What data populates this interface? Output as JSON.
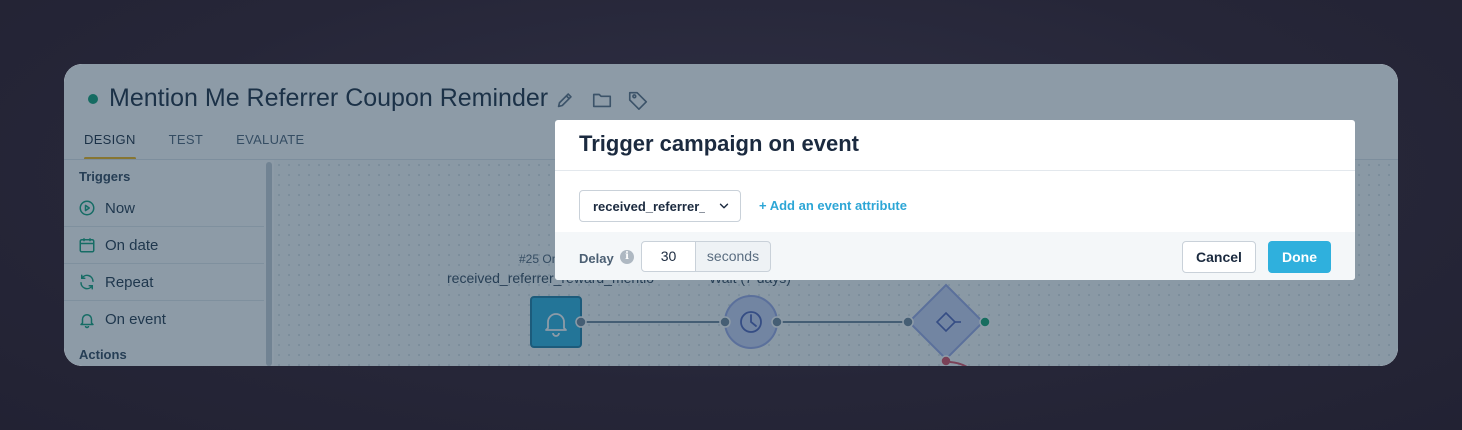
{
  "campaign": {
    "title": "Mention Me Referrer Coupon Reminder",
    "status_color": "#0f9f74",
    "header_icons": [
      "edit-icon",
      "folder-icon",
      "tag-icon"
    ]
  },
  "tabs": [
    {
      "label": "DESIGN",
      "active": true
    },
    {
      "label": "TEST",
      "active": false
    },
    {
      "label": "EVALUATE",
      "active": false
    }
  ],
  "sidebar": {
    "triggers_heading": "Triggers",
    "items": [
      {
        "label": "Now",
        "icon": "play-circle-icon"
      },
      {
        "label": "On date",
        "icon": "calendar-icon"
      },
      {
        "label": "Repeat",
        "icon": "repeat-icon"
      },
      {
        "label": "On event",
        "icon": "bell-icon"
      }
    ],
    "actions_heading": "Actions"
  },
  "canvas": {
    "trigger_node": {
      "id_label": "#25 On",
      "event_label": "received_referrer_reward_mentio",
      "icon": "bell-icon"
    },
    "wait_node": {
      "label": "Wait (7 days)",
      "icon": "clock-icon"
    },
    "split_node": {
      "icon": "split-icon"
    }
  },
  "modal": {
    "title": "Trigger campaign on event",
    "event_select": {
      "value": "received_referrer_reward_mentionme"
    },
    "add_attribute_label": "+ Add an event attribute",
    "delay_label": "Delay",
    "delay_value": "30",
    "delay_unit": "seconds",
    "cancel_label": "Cancel",
    "done_label": "Done"
  },
  "colors": {
    "accent": "#2fb0dd",
    "active_tab_underline": "#f3b515",
    "sidebar_icon": "#11a17b"
  }
}
